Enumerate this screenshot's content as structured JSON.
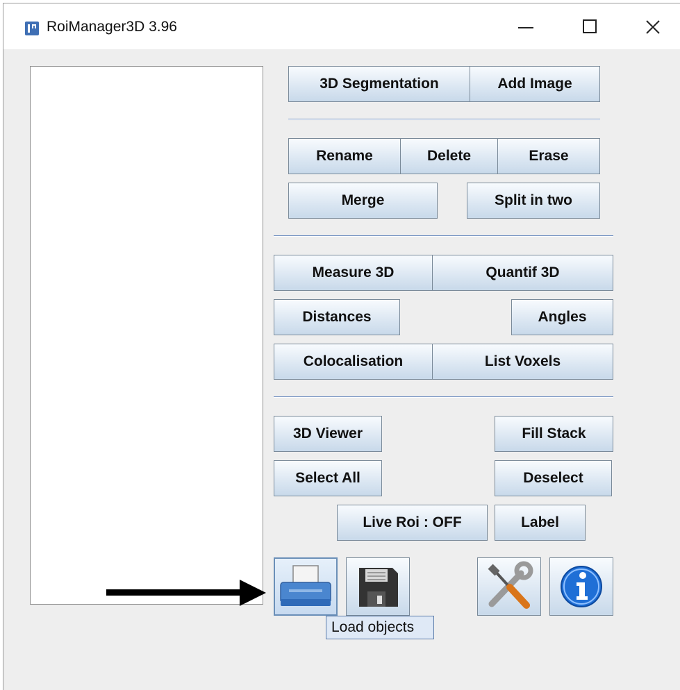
{
  "window": {
    "title": "RoiManager3D 3.96"
  },
  "buttons": {
    "segmentation": "3D Segmentation",
    "add_image": "Add Image",
    "rename": "Rename",
    "delete": "Delete",
    "erase": "Erase",
    "merge": "Merge",
    "split": "Split in two",
    "measure": "Measure 3D",
    "quantif": "Quantif 3D",
    "distances": "Distances",
    "angles": "Angles",
    "colocalisation": "Colocalisation",
    "list_voxels": "List Voxels",
    "viewer": "3D Viewer",
    "fill_stack": "Fill Stack",
    "select_all": "Select All",
    "deselect": "Deselect",
    "live_roi": "Live Roi : OFF",
    "label": "Label"
  },
  "icon_buttons": [
    "printer-icon",
    "floppy-disk-icon",
    "tools-icon",
    "info-icon"
  ],
  "tooltip": {
    "text": "Load objects"
  },
  "colors": {
    "accent": "#3f6fb4",
    "info_blue": "#1f6fd6",
    "separator": "#6f8fc0"
  }
}
